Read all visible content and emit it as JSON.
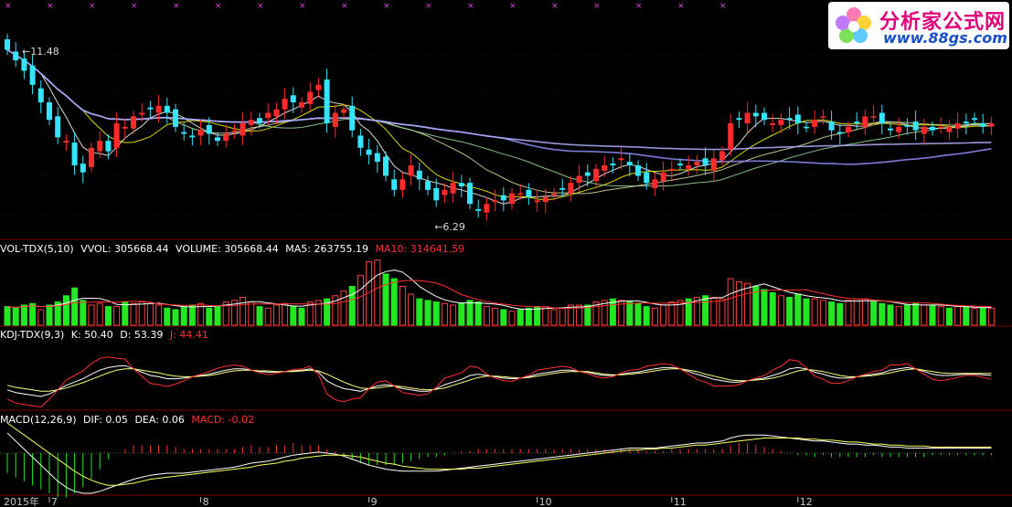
{
  "logo": {
    "site_name": "分析家公式网",
    "url": "www.88gs.com"
  },
  "panels": {
    "volume": {
      "title": "VOL-TDX(5,10)",
      "items": [
        "VVOL: 305668.44",
        "VOLUME: 305668.44",
        "MA5: 263755.19",
        "MA10: 314641.59"
      ]
    },
    "kdj": {
      "title": "KDJ-TDX(9,3)",
      "items": [
        "K: 50.40",
        "D: 53.39",
        "J: 44.41"
      ]
    },
    "macd": {
      "title": "MACD(12,26,9)",
      "items": [
        "DIF: 0.05",
        "DEA: 0.06",
        "MACD: -0.02"
      ]
    }
  },
  "colors": {
    "up": "#ff2b2b",
    "down": "#33e5ff",
    "vol_up": "#ff4040",
    "vol_down": "#22e822",
    "ma_purple": "#ff33ff"
  },
  "chart_data": [
    {
      "type": "candlestick",
      "annotations": [
        "11.48",
        "6.29"
      ],
      "x_tick_labels": [
        "2015年",
        "7",
        "8",
        "9",
        "10",
        "11",
        "12"
      ],
      "close": [
        10.9,
        10.6,
        10.3,
        9.9,
        9.4,
        8.9,
        8.4,
        8.3,
        7.6,
        7.4,
        8.1,
        8.3,
        8.0,
        8.8,
        8.7,
        9.0,
        9.1,
        9.2,
        9.3,
        9.1,
        8.7,
        8.5,
        8.4,
        8.6,
        8.5,
        8.3,
        8.5,
        8.6,
        8.8,
        8.9,
        8.8,
        9.1,
        9.2,
        9.5,
        9.4,
        9.4,
        9.7,
        9.9,
        8.8,
        9.1,
        9.2,
        8.6,
        8.1,
        7.9,
        7.7,
        7.3,
        6.9,
        7.2,
        7.6,
        7.2,
        6.9,
        6.6,
        6.9,
        7.1,
        7.0,
        6.5,
        6.3,
        6.5,
        6.6,
        6.6,
        6.8,
        6.8,
        6.7,
        6.6,
        6.7,
        6.8,
        6.9,
        7.1,
        7.3,
        7.3,
        7.5,
        7.6,
        7.6,
        7.8,
        7.6,
        7.3,
        7.1,
        7.2,
        7.4,
        7.5,
        7.6,
        7.6,
        7.7,
        7.6,
        7.8,
        8.0,
        8.8,
        8.9,
        9.1,
        9.0,
        8.9,
        8.8,
        8.9,
        8.9,
        8.8,
        8.7,
        8.9,
        9.0,
        8.6,
        8.5,
        8.7,
        8.8,
        9.0,
        9.0,
        8.8,
        8.6,
        8.7,
        8.7,
        8.6,
        8.7,
        8.6,
        8.7,
        8.7,
        8.8,
        8.8,
        8.9,
        8.7,
        8.8
      ],
      "ma_periods": [
        5,
        10,
        20,
        30,
        60,
        120
      ]
    },
    {
      "type": "bar",
      "name": "VOL-TDX(5,10)",
      "values": [
        120,
        110,
        130,
        140,
        100,
        130,
        150,
        190,
        240,
        160,
        130,
        140,
        120,
        120,
        150,
        140,
        150,
        140,
        130,
        110,
        100,
        120,
        130,
        140,
        110,
        120,
        150,
        160,
        180,
        150,
        120,
        110,
        130,
        140,
        120,
        110,
        150,
        160,
        170,
        190,
        220,
        250,
        320,
        410,
        420,
        330,
        300,
        250,
        200,
        170,
        160,
        150,
        140,
        130,
        140,
        160,
        150,
        120,
        110,
        100,
        90,
        100,
        110,
        120,
        120,
        100,
        110,
        130,
        130,
        130,
        150,
        160,
        170,
        160,
        150,
        140,
        120,
        110,
        130,
        150,
        160,
        170,
        180,
        190,
        180,
        170,
        300,
        280,
        270,
        250,
        230,
        210,
        190,
        180,
        200,
        170,
        170,
        160,
        150,
        140,
        160,
        170,
        170,
        150,
        140,
        130,
        120,
        130,
        140,
        130,
        130,
        120,
        110,
        120,
        120,
        110,
        110,
        110
      ],
      "up": [
        false,
        false,
        false,
        false,
        true,
        false,
        false,
        false,
        false,
        false,
        true,
        true,
        false,
        true,
        false,
        true,
        true,
        true,
        true,
        false,
        false,
        false,
        false,
        true,
        false,
        false,
        true,
        true,
        true,
        true,
        false,
        true,
        true,
        true,
        false,
        false,
        true,
        true,
        false,
        true,
        true,
        false,
        true,
        true,
        true,
        false,
        false,
        true,
        true,
        false,
        false,
        false,
        true,
        true,
        false,
        false,
        false,
        true,
        true,
        false,
        true,
        false,
        false,
        false,
        true,
        true,
        true,
        true,
        true,
        false,
        true,
        true,
        false,
        true,
        false,
        false,
        false,
        true,
        true,
        true,
        true,
        false,
        true,
        false,
        true,
        true,
        true,
        true,
        true,
        false,
        false,
        false,
        true,
        false,
        false,
        false,
        true,
        true,
        false,
        false,
        true,
        true,
        true,
        false,
        false,
        false,
        true,
        false,
        false,
        true,
        false,
        true,
        false,
        true,
        false,
        true,
        false,
        true
      ]
    },
    {
      "type": "line",
      "name": "KDJ-TDX(9,3)",
      "series": [
        {
          "name": "K",
          "values": [
            28,
            24,
            22,
            20,
            18,
            22,
            28,
            35,
            40,
            45,
            52,
            58,
            62,
            64,
            65,
            60,
            55,
            50,
            48,
            45,
            45,
            46,
            48,
            50,
            52,
            55,
            58,
            60,
            60,
            58,
            56,
            55,
            55,
            56,
            57,
            58,
            60,
            55,
            42,
            35,
            30,
            28,
            26,
            30,
            34,
            36,
            34,
            30,
            28,
            26,
            26,
            30,
            36,
            40,
            44,
            50,
            52,
            50,
            48,
            46,
            45,
            46,
            48,
            52,
            54,
            56,
            58,
            58,
            56,
            55,
            52,
            50,
            50,
            52,
            54,
            55,
            58,
            60,
            62,
            62,
            60,
            56,
            52,
            48,
            44,
            42,
            40,
            40,
            42,
            44,
            46,
            50,
            54,
            60,
            62,
            60,
            55,
            52,
            48,
            46,
            46,
            48,
            50,
            52,
            54,
            58,
            60,
            62,
            60,
            56,
            52,
            50,
            50,
            51,
            52,
            52,
            51,
            50
          ]
        },
        {
          "name": "D",
          "values": [
            35,
            32,
            30,
            28,
            26,
            26,
            28,
            31,
            35,
            39,
            44,
            49,
            54,
            58,
            60,
            60,
            58,
            56,
            54,
            51,
            49,
            48,
            48,
            49,
            50,
            52,
            55,
            57,
            58,
            58,
            57,
            57,
            56,
            56,
            56,
            57,
            58,
            57,
            52,
            46,
            40,
            35,
            31,
            30,
            31,
            33,
            34,
            33,
            31,
            29,
            28,
            29,
            31,
            35,
            39,
            43,
            47,
            49,
            49,
            48,
            47,
            46,
            47,
            49,
            51,
            53,
            55,
            56,
            56,
            56,
            54,
            52,
            51,
            51,
            52,
            53,
            55,
            57,
            59,
            60,
            60,
            58,
            56,
            52,
            49,
            46,
            43,
            42,
            42,
            43,
            44,
            46,
            49,
            53,
            57,
            59,
            58,
            56,
            53,
            50,
            48,
            48,
            49,
            50,
            52,
            54,
            57,
            59,
            60,
            58,
            56,
            54,
            53,
            53,
            53,
            53,
            53,
            53
          ]
        },
        {
          "name": "J",
          "values": [
            14,
            8,
            6,
            4,
            2,
            14,
            28,
            43,
            50,
            57,
            68,
            76,
            78,
            76,
            75,
            60,
            49,
            38,
            36,
            33,
            37,
            42,
            48,
            52,
            56,
            61,
            64,
            66,
            64,
            58,
            54,
            51,
            53,
            56,
            59,
            60,
            64,
            51,
            22,
            13,
            10,
            14,
            16,
            30,
            40,
            42,
            34,
            24,
            22,
            20,
            22,
            32,
            46,
            50,
            54,
            64,
            62,
            52,
            46,
            42,
            41,
            46,
            50,
            58,
            60,
            62,
            64,
            62,
            56,
            53,
            48,
            46,
            48,
            54,
            58,
            59,
            64,
            66,
            68,
            66,
            60,
            52,
            44,
            40,
            34,
            34,
            34,
            36,
            42,
            46,
            50,
            58,
            64,
            74,
            72,
            62,
            49,
            44,
            38,
            38,
            42,
            48,
            52,
            56,
            58,
            66,
            66,
            68,
            60,
            52,
            44,
            42,
            44,
            47,
            50,
            50,
            47,
            44
          ]
        }
      ]
    },
    {
      "type": "line",
      "name": "MACD(12,26,9)",
      "series": [
        {
          "name": "DIF",
          "values": [
            0.2,
            0.12,
            0.04,
            -0.04,
            -0.12,
            -0.2,
            -0.28,
            -0.34,
            -0.38,
            -0.4,
            -0.4,
            -0.38,
            -0.35,
            -0.32,
            -0.29,
            -0.26,
            -0.24,
            -0.22,
            -0.21,
            -0.2,
            -0.2,
            -0.2,
            -0.19,
            -0.18,
            -0.17,
            -0.16,
            -0.15,
            -0.14,
            -0.12,
            -0.1,
            -0.09,
            -0.08,
            -0.06,
            -0.04,
            -0.02,
            -0.01,
            0.0,
            0.01,
            0.0,
            -0.01,
            -0.03,
            -0.06,
            -0.09,
            -0.12,
            -0.14,
            -0.16,
            -0.17,
            -0.18,
            -0.18,
            -0.18,
            -0.18,
            -0.18,
            -0.17,
            -0.16,
            -0.15,
            -0.14,
            -0.13,
            -0.12,
            -0.11,
            -0.1,
            -0.09,
            -0.08,
            -0.07,
            -0.06,
            -0.05,
            -0.04,
            -0.03,
            -0.02,
            -0.01,
            0.0,
            0.01,
            0.02,
            0.03,
            0.04,
            0.05,
            0.05,
            0.05,
            0.05,
            0.06,
            0.07,
            0.08,
            0.09,
            0.1,
            0.1,
            0.11,
            0.12,
            0.15,
            0.17,
            0.18,
            0.18,
            0.18,
            0.17,
            0.16,
            0.15,
            0.14,
            0.13,
            0.12,
            0.12,
            0.11,
            0.1,
            0.09,
            0.09,
            0.08,
            0.08,
            0.07,
            0.06,
            0.06,
            0.05,
            0.05,
            0.05,
            0.05,
            0.05,
            0.05,
            0.05,
            0.05,
            0.05,
            0.05,
            0.05
          ]
        },
        {
          "name": "DEA",
          "values": [
            0.3,
            0.24,
            0.18,
            0.12,
            0.06,
            0.0,
            -0.06,
            -0.12,
            -0.18,
            -0.23,
            -0.27,
            -0.3,
            -0.32,
            -0.32,
            -0.31,
            -0.3,
            -0.28,
            -0.26,
            -0.25,
            -0.24,
            -0.23,
            -0.22,
            -0.21,
            -0.2,
            -0.19,
            -0.18,
            -0.17,
            -0.16,
            -0.15,
            -0.14,
            -0.12,
            -0.11,
            -0.1,
            -0.08,
            -0.07,
            -0.05,
            -0.04,
            -0.03,
            -0.02,
            -0.02,
            -0.02,
            -0.03,
            -0.04,
            -0.06,
            -0.08,
            -0.1,
            -0.11,
            -0.13,
            -0.14,
            -0.15,
            -0.16,
            -0.16,
            -0.16,
            -0.16,
            -0.16,
            -0.15,
            -0.15,
            -0.14,
            -0.13,
            -0.12,
            -0.11,
            -0.1,
            -0.09,
            -0.08,
            -0.07,
            -0.06,
            -0.05,
            -0.04,
            -0.03,
            -0.02,
            -0.01,
            0.0,
            0.01,
            0.02,
            0.03,
            0.03,
            0.04,
            0.04,
            0.05,
            0.05,
            0.06,
            0.07,
            0.08,
            0.08,
            0.09,
            0.1,
            0.11,
            0.12,
            0.13,
            0.14,
            0.15,
            0.15,
            0.15,
            0.15,
            0.15,
            0.14,
            0.14,
            0.13,
            0.13,
            0.12,
            0.11,
            0.11,
            0.1,
            0.09,
            0.09,
            0.08,
            0.08,
            0.07,
            0.07,
            0.07,
            0.06,
            0.06,
            0.06,
            0.06,
            0.06,
            0.06,
            0.06,
            0.06
          ]
        }
      ]
    }
  ]
}
